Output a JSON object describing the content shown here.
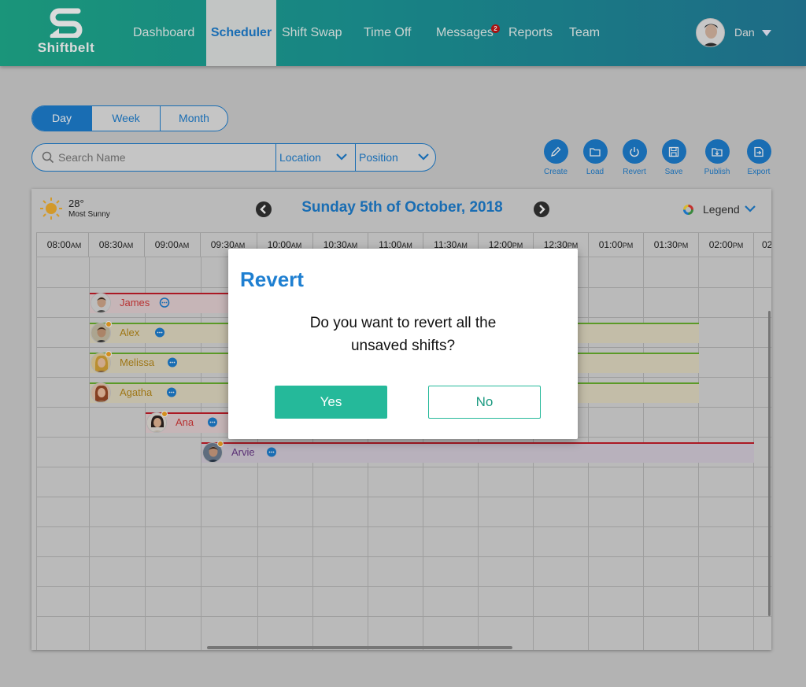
{
  "brand": {
    "name": "Shiftbelt",
    "logo_icon": "swap-s-logo"
  },
  "nav": {
    "items": [
      {
        "label": "Dashboard"
      },
      {
        "label": "Scheduler",
        "active": true
      },
      {
        "label": "Shift Swap"
      },
      {
        "label": "Time Off"
      },
      {
        "label": "Messages",
        "badge": "2"
      },
      {
        "label": "Reports"
      },
      {
        "label": "Team"
      }
    ]
  },
  "user": {
    "name": "Dan"
  },
  "view_toggle": {
    "options": [
      "Day",
      "Week",
      "Month"
    ],
    "active": "Day"
  },
  "search": {
    "placeholder": "Search Name",
    "location_label": "Location",
    "position_label": "Position"
  },
  "toolbar": {
    "actions": [
      {
        "label": "Create",
        "icon": "pencil-icon"
      },
      {
        "label": "Load",
        "icon": "folder-icon"
      },
      {
        "label": "Revert",
        "icon": "power-icon"
      },
      {
        "label": "Save",
        "icon": "floppy-icon"
      },
      {
        "label": "Publish",
        "icon": "publish-icon"
      },
      {
        "label": "Export",
        "icon": "export-icon"
      }
    ]
  },
  "weather": {
    "temp": "28°",
    "condition": "Most Sunny"
  },
  "schedule": {
    "date_title": "Sunday 5th of October, 2018",
    "legend_label": "Legend",
    "times": [
      {
        "t": "08:00",
        "p": "AM"
      },
      {
        "t": "08:30",
        "p": "AM"
      },
      {
        "t": "09:00",
        "p": "AM"
      },
      {
        "t": "09:30",
        "p": "AM"
      },
      {
        "t": "10:00",
        "p": "AM"
      },
      {
        "t": "10:30",
        "p": "AM"
      },
      {
        "t": "11:00",
        "p": "AM"
      },
      {
        "t": "11:30",
        "p": "AM"
      },
      {
        "t": "12:00",
        "p": "PM"
      },
      {
        "t": "12:30",
        "p": "PM"
      },
      {
        "t": "01:00",
        "p": "PM"
      },
      {
        "t": "01:30",
        "p": "PM"
      },
      {
        "t": "02:00",
        "p": "PM"
      },
      {
        "t": "02",
        "p": ""
      }
    ],
    "shifts": [
      {
        "name": "James",
        "color": "#d63a3a",
        "bar_color": "#e7d3d6",
        "line_color": "#c71e2b"
      },
      {
        "name": "Alex",
        "color": "#b88a1a",
        "bar_color": "#e4dcc4",
        "line_color": "#6ab42e"
      },
      {
        "name": "Melissa",
        "color": "#b88a1a",
        "bar_color": "#e4dcc4",
        "line_color": "#6ab42e"
      },
      {
        "name": "Agatha",
        "color": "#b88a1a",
        "bar_color": "#e4dcc4",
        "line_color": "#6ab42e"
      },
      {
        "name": "Ana",
        "color": "#d63a3a",
        "bar_color": "#e7d3d6",
        "line_color": "#c71e2b"
      },
      {
        "name": "Arvie",
        "color": "#6a3a8a",
        "bar_color": "#d7cedb",
        "line_color": "#c71e2b"
      }
    ]
  },
  "modal": {
    "title": "Revert",
    "message": "Do you want to revert all the unsaved shifts?",
    "yes_label": "Yes",
    "no_label": "No"
  },
  "colors": {
    "accent": "#1e7fd1",
    "teal": "#25b99a"
  }
}
